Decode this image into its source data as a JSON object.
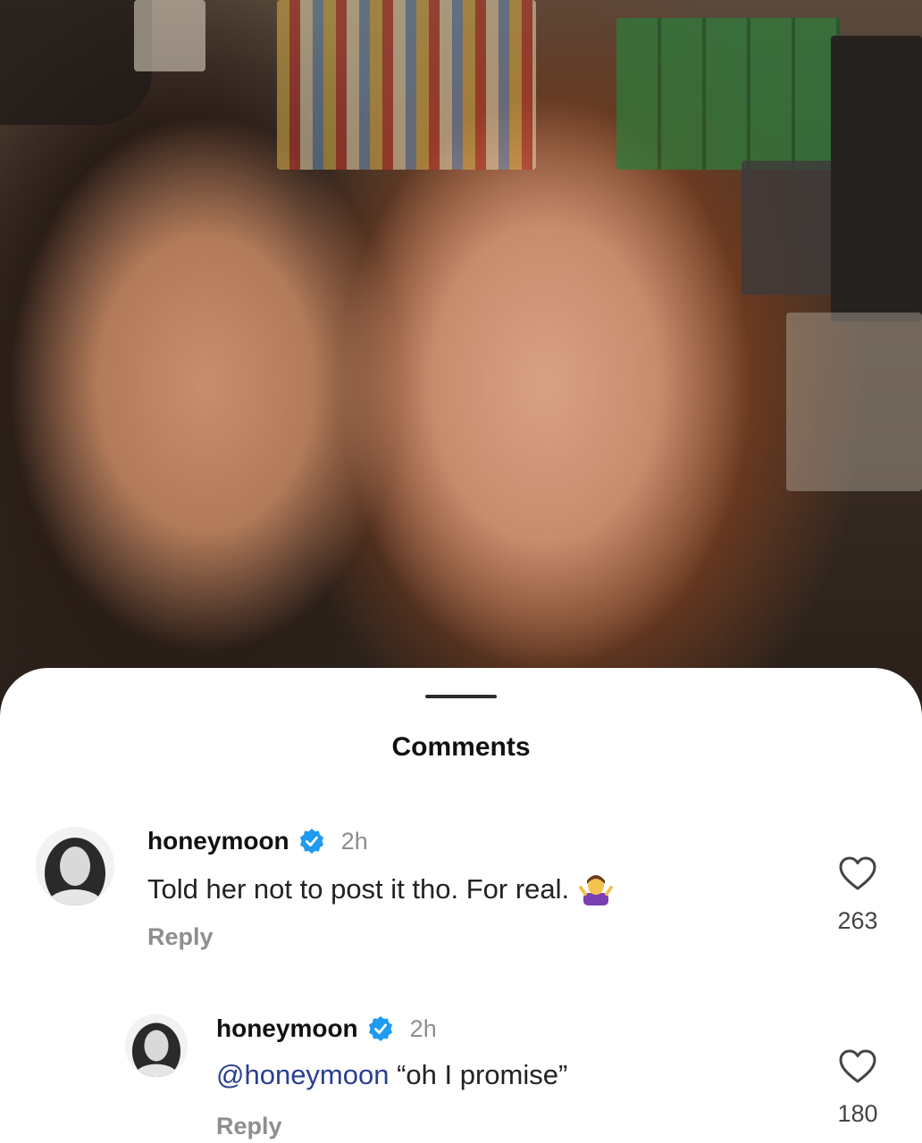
{
  "sheet": {
    "title": "Comments"
  },
  "comments": [
    {
      "username": "honeymoon",
      "verified": true,
      "time": "2h",
      "text": "Told her not to post it tho. For real.",
      "emoji": "person-shrugging-emoji",
      "reply_label": "Reply",
      "likes": "263"
    },
    {
      "username": "honeymoon",
      "verified": true,
      "time": "2h",
      "mention": "@honeymoon",
      "text": " “oh I promise”",
      "reply_label": "Reply",
      "likes": "180"
    }
  ],
  "colors": {
    "verified": "#1d9bf0",
    "mention": "#2a3f8f",
    "muted": "#8e8e8e"
  },
  "icons": [
    "verified-badge-icon",
    "heart-icon",
    "avatar-photo"
  ]
}
